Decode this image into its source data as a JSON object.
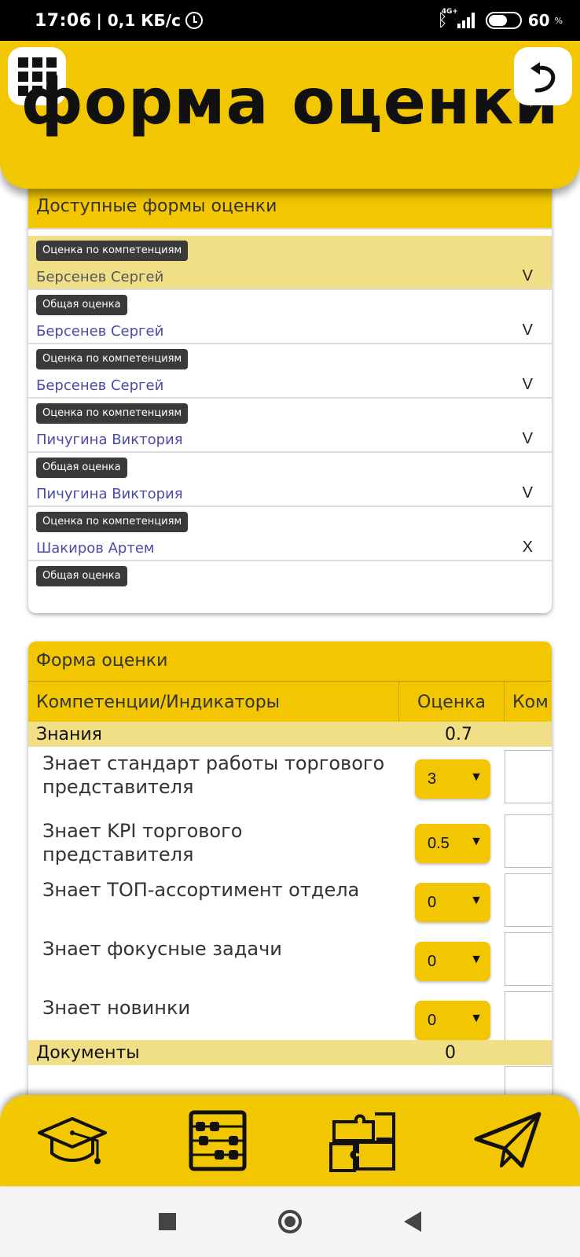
{
  "status_bar": {
    "time": "17:06",
    "speed": "| 0,1 КБ/с",
    "network": "4G+",
    "battery_percent": "60",
    "percent_sign": "%"
  },
  "header": {
    "title": "форма оценки",
    "menu_icon": "grid-icon",
    "back_icon": "undo-icon",
    "color": "#f2c600"
  },
  "available_forms": {
    "title": "Доступные формы оценки",
    "items": [
      {
        "type": "Оценка по компетенциям",
        "person": "Берсенев Сергей",
        "mark": "V",
        "selected": true
      },
      {
        "type": "Общая оценка",
        "person": "Берсенев Сергей",
        "mark": "V",
        "selected": false
      },
      {
        "type": "Оценка по компетенциям",
        "person": "Берсенев Сергей",
        "mark": "V",
        "selected": false
      },
      {
        "type": "Оценка по компетенциям",
        "person": "Пичугина Виктория",
        "mark": "V",
        "selected": false
      },
      {
        "type": "Общая оценка",
        "person": "Пичугина Виктория",
        "mark": "V",
        "selected": false
      },
      {
        "type": "Оценка по компетенциям",
        "person": "Шакиров Артем",
        "mark": "X",
        "selected": false
      },
      {
        "type": "Общая оценка",
        "person": "",
        "mark": "",
        "selected": false
      }
    ]
  },
  "assessment_form": {
    "title": "Форма оценки",
    "columns": [
      "Компетенции/Индикаторы",
      "Оценка",
      "Ком"
    ],
    "sections": [
      {
        "name": "Знания",
        "score": "0.7",
        "rows": [
          {
            "label": "Знает стандарт работы торгового представителя",
            "value": "3"
          },
          {
            "label": "Знает KPI торгового представителя",
            "value": "0.5"
          },
          {
            "label": "Знает ТОП-ассортимент отдела",
            "value": "0"
          },
          {
            "label": "Знает фокусные задачи",
            "value": "0"
          },
          {
            "label": "Знает новинки",
            "value": "0"
          }
        ]
      },
      {
        "name": "Документы",
        "score": "0",
        "rows": []
      }
    ],
    "select_arrow": "▼"
  },
  "bottom_nav": [
    {
      "name": "graduation-cap-icon"
    },
    {
      "name": "abacus-icon"
    },
    {
      "name": "puzzle-icon"
    },
    {
      "name": "paper-plane-icon"
    }
  ]
}
